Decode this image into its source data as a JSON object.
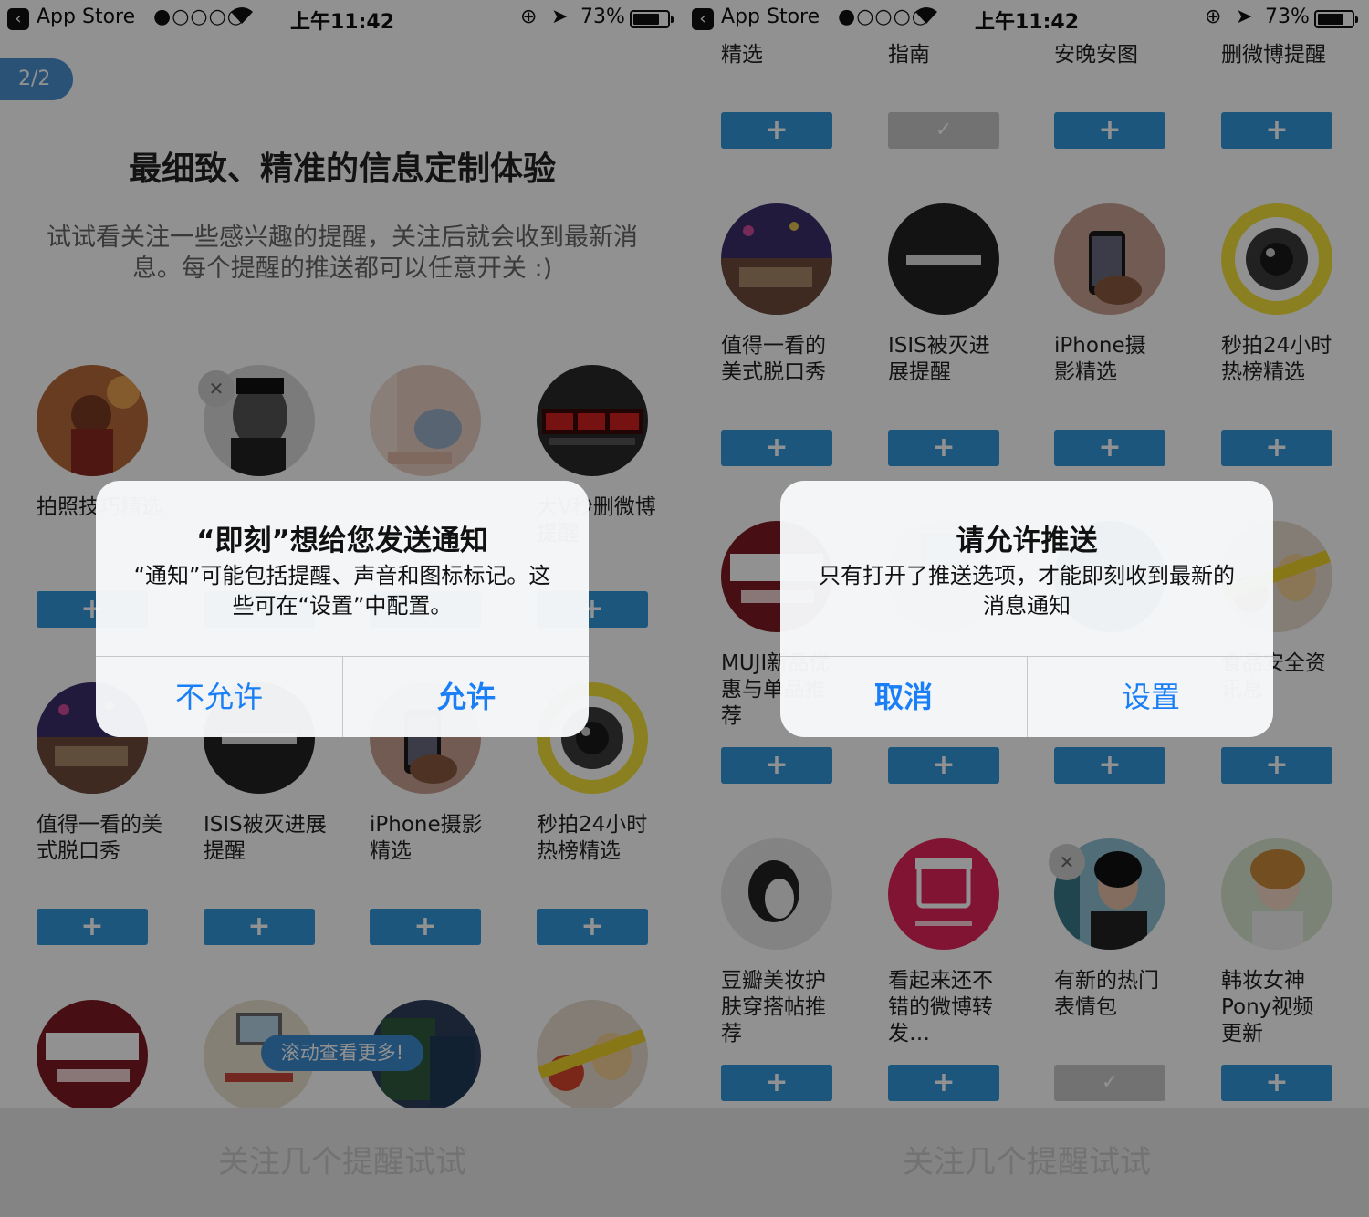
{
  "statusbar": {
    "back_glyph": "‹",
    "carrier": "App Store",
    "signal": "●○○○○",
    "wifi": "wifi-icon",
    "time": "上午11:42",
    "lock_glyph": "⊕",
    "location_glyph": "➤",
    "battery": "73%"
  },
  "left": {
    "page_indicator": "2/2",
    "headline": "最细致、精准的信息定制体验",
    "subtitle": "试试看关注一些感兴趣的提醒，关注后就会收到最新消息。每个提醒的推送都可以任意开关 :)",
    "cards": [
      {
        "label": "拍照技巧精选",
        "button": "+"
      },
      {
        "label": "",
        "button": "+"
      },
      {
        "label": "",
        "button": "+"
      },
      {
        "label": "大V秒删微博提醒",
        "button": "+"
      },
      {
        "label": "值得一看的美式脱口秀",
        "button": "+"
      },
      {
        "label": "ISIS被灭进展提醒",
        "button": "+"
      },
      {
        "label": "iPhone摄影精选",
        "button": "+"
      },
      {
        "label": "秒拍24小时热榜精选",
        "button": "+"
      }
    ],
    "scroll_hint": "滚动查看更多!",
    "bottom_action": "关注几个提醒试试",
    "alert": {
      "title": "“即刻”想给您发送通知",
      "message": "“通知”可能包括提醒、声音和图标标记。这些可在“设置”中配置。",
      "deny": "不允许",
      "allow": "允许"
    }
  },
  "right": {
    "top_labels": [
      "精选",
      "指南",
      "安晚安图",
      "删微博提醒"
    ],
    "row2": [
      {
        "label": "值得一看的美式脱口秀",
        "button": "+"
      },
      {
        "label": "ISIS被灭进展提醒",
        "button": "+"
      },
      {
        "label": "iPhone摄影精选",
        "button": "+"
      },
      {
        "label": "秒拍24小时热榜精选",
        "button": "+"
      }
    ],
    "row3": [
      {
        "label": "MUJI新品优惠与单品推荐",
        "button": "+"
      },
      {
        "label": "",
        "button": "+"
      },
      {
        "label": "",
        "button": "+"
      },
      {
        "label": "食品安全资讯息",
        "button": "+"
      }
    ],
    "row4": [
      {
        "label": "豆瓣美妆护肤穿搭帖推荐",
        "button": "+"
      },
      {
        "label": "看起来还不错的微博转发…",
        "button": "+"
      },
      {
        "label": "有新的热门表情包",
        "button": "✓"
      },
      {
        "label": "韩妆女神Pony视频更新",
        "button": "+"
      }
    ],
    "bottom_action": "关注几个提醒试试",
    "alert": {
      "title": "请允许推送",
      "message": "只有打开了推送选项，才能即刻收到最新的消息通知",
      "cancel": "取消",
      "settings": "设置"
    }
  },
  "colors": {
    "accent": "#3498db",
    "alert_button": "#1a7ff6",
    "badge": "#4a90d0"
  }
}
